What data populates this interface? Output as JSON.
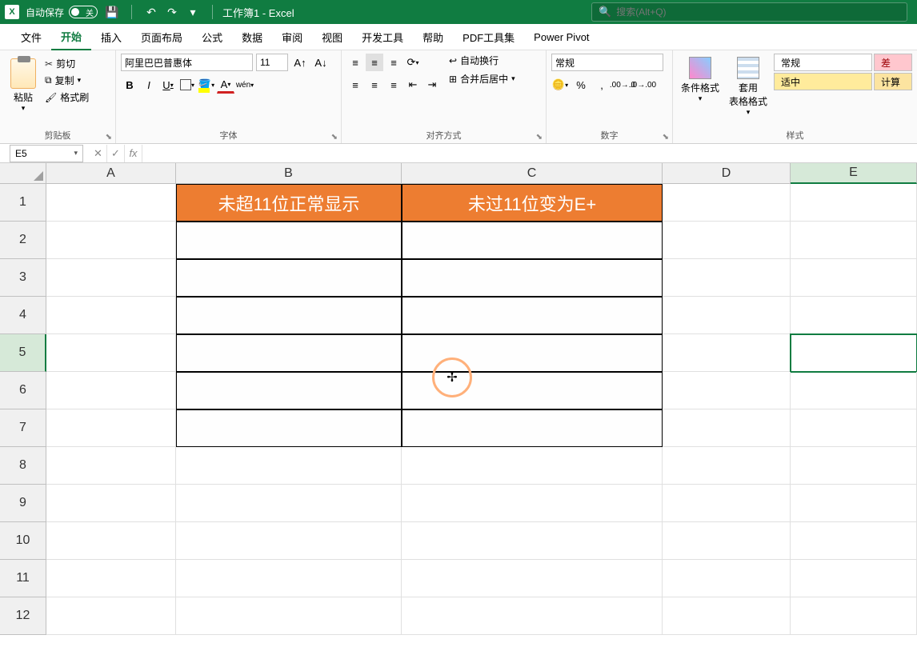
{
  "titlebar": {
    "autosave_label": "自动保存",
    "autosave_state": "关",
    "title": "工作簿1 - Excel",
    "search_placeholder": "搜索(Alt+Q)"
  },
  "tabs": [
    "文件",
    "开始",
    "插入",
    "页面布局",
    "公式",
    "数据",
    "审阅",
    "视图",
    "开发工具",
    "帮助",
    "PDF工具集",
    "Power Pivot"
  ],
  "active_tab_index": 1,
  "ribbon": {
    "clipboard": {
      "paste": "粘贴",
      "cut": "剪切",
      "copy": "复制",
      "format_painter": "格式刷",
      "group": "剪贴板"
    },
    "font": {
      "family": "阿里巴巴普惠体",
      "size": "11",
      "group": "字体"
    },
    "align": {
      "wrap": "自动换行",
      "merge": "合并后居中",
      "group": "对齐方式"
    },
    "number": {
      "format": "常规",
      "group": "数字"
    },
    "styles": {
      "conditional": "条件格式",
      "format_table": "套用\n表格格式",
      "normal": "常规",
      "bad": "差",
      "good": "适中",
      "calc": "计算",
      "group": "样式"
    }
  },
  "namebox": "E5",
  "formula": "",
  "columns": [
    "A",
    "B",
    "C",
    "D",
    "E"
  ],
  "rows": [
    1,
    2,
    3,
    4,
    5,
    6,
    7,
    8,
    9,
    10,
    11,
    12
  ],
  "selected_cell": {
    "col": "E",
    "row": 5
  },
  "table": {
    "header_b": "未超11位正常显示",
    "header_c": "未过11位变为E+"
  },
  "chart_data": null
}
